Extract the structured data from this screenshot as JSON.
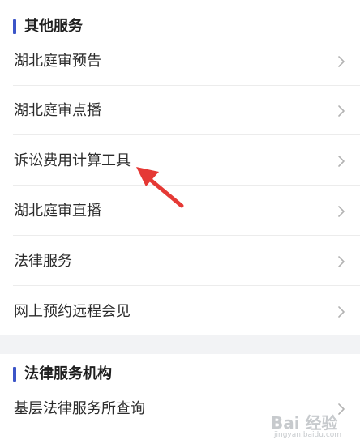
{
  "sections": [
    {
      "title": "其他服务",
      "items": [
        {
          "label": "湖北庭审预告"
        },
        {
          "label": "湖北庭审点播"
        },
        {
          "label": "诉讼费用计算工具"
        },
        {
          "label": "湖北庭审直播"
        },
        {
          "label": "法律服务"
        },
        {
          "label": "网上预约远程会见"
        }
      ]
    },
    {
      "title": "法律服务机构",
      "items": [
        {
          "label": "基层法律服务所查询"
        }
      ]
    }
  ],
  "colors": {
    "accent": "#3c55c8",
    "arrow": "#e53935",
    "background": "#f2f3f5"
  },
  "icons": {
    "row_chevron": "chevron-right-icon",
    "annotation": "red-arrow-icon"
  },
  "watermark": {
    "text": "Bai 经验",
    "sub": "jingyan.baidu.com"
  }
}
